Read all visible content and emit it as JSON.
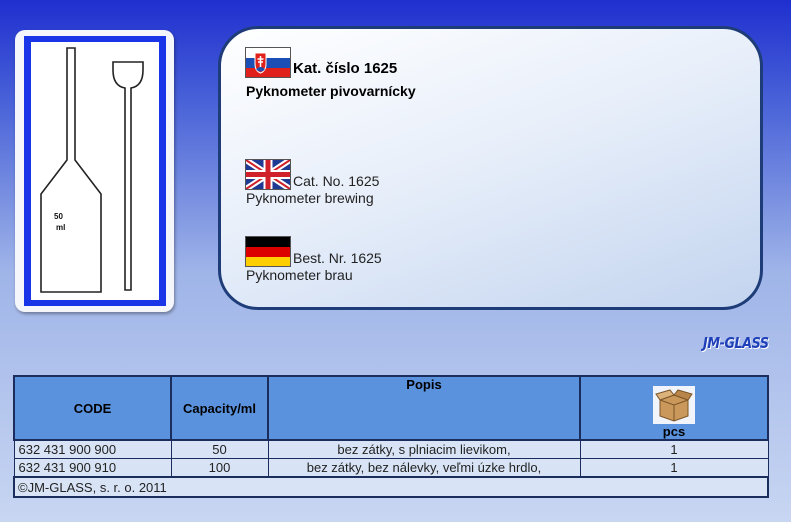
{
  "info": {
    "sk": {
      "catalog": "Kat. číslo 1625",
      "name": "Pyknometer pivovarnícky"
    },
    "en": {
      "catalog": "Cat. No. 1625",
      "name": "Pyknometer brewing"
    },
    "de": {
      "catalog": "Best. Nr. 1625",
      "name": "Pyknometer brau"
    }
  },
  "product_image": {
    "volume_label_number": "50",
    "volume_label_unit": "ml"
  },
  "logo": {
    "text": "JM-GLASS"
  },
  "table": {
    "headers": {
      "code": "CODE",
      "capacity": "Capacity/ml",
      "description": "Popis",
      "pcs": "pcs"
    },
    "rows": [
      {
        "code": "632 431 900 900",
        "capacity": "50",
        "description": "bez zátky, s plniacim lievikom,",
        "pcs": "1"
      },
      {
        "code": "632 431 900 910",
        "capacity": "100",
        "description": "bez zátky, bez nálevky, veľmi úzke hrdlo,",
        "pcs": "1"
      }
    ],
    "footer": "©JM-GLASS, s. r. o. 2011"
  },
  "colors": {
    "header_bg": "#5a92de",
    "row_bg": "#d8e4f6",
    "frame_blue": "#1a35e8",
    "panel_border": "#1e3c78"
  }
}
